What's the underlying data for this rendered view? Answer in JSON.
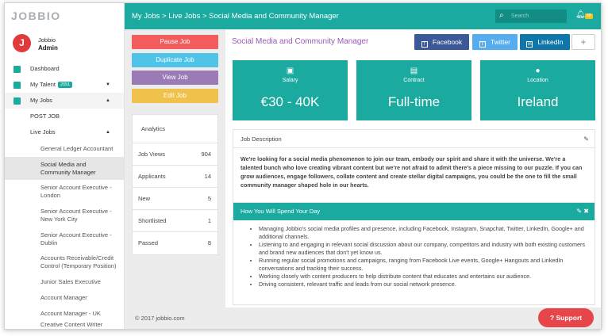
{
  "brand": {
    "logo": "JOBBIO"
  },
  "profile": {
    "initial": "J",
    "name": "Jobbio",
    "role": "Admin"
  },
  "nav": {
    "dashboard": "Dashboard",
    "talent": "My Talent",
    "talent_badge": "2051",
    "jobs": "My Jobs",
    "post_job": "POST JOB",
    "live_jobs": "Live Jobs",
    "live_items": [
      "General Ledger Accountant",
      "Social Media and Community Manager",
      "Senior Account Executive - London",
      "Senior Account Executive - New York City",
      "Senior Account Executive - Dublin",
      "Accounts Receivable/Credit Control (Temporary Position)",
      "Junior Sales Executive",
      "Account Manager",
      "Account Manager - UK",
      "Creative Content Writer"
    ]
  },
  "topbar": {
    "breadcrumb": "My Jobs > Live Jobs > Social Media and Community Manager",
    "search_placeholder": "Search",
    "notif_count": "99"
  },
  "actions": {
    "pause": "Pause Job",
    "duplicate": "Duplicate Job",
    "view": "View Job",
    "edit": "Edit Job"
  },
  "analytics": {
    "title": "Analytics",
    "rows": [
      {
        "label": "Job Views",
        "value": "904"
      },
      {
        "label": "Applicants",
        "value": "14"
      },
      {
        "label": "New",
        "value": "5"
      },
      {
        "label": "Shortlisted",
        "value": "1"
      },
      {
        "label": "Passed",
        "value": "8"
      }
    ]
  },
  "job": {
    "title": "Social Media and Community Manager",
    "share": {
      "facebook": "Facebook",
      "twitter": "Twitter",
      "linkedin": "LinkedIn",
      "more": "+"
    },
    "cards": [
      {
        "label": "Salary",
        "value": "€30 - 40K",
        "icon": "briefcase-icon"
      },
      {
        "label": "Contract",
        "value": "Full-time",
        "icon": "document-icon"
      },
      {
        "label": "Location",
        "value": "Ireland",
        "icon": "map-pin-icon"
      }
    ],
    "description_title": "Job Description",
    "description": "We're looking for a social media phenomenon to join our team, embody our spirit and share it with the universe. We're a talented bunch who love creating vibrant content but we're not afraid to admit there's a piece missing to our puzzle. If you can grow audiences, engage followers, collate content and create stellar digital campaigns, you could be the one to fill the small community manager shaped hole in our hearts.",
    "spend_title": "How You Will Spend Your Day",
    "spend_items": [
      "Managing Jobbio's social media profiles and presence, including Facebook, Instagram, Snapchat, Twitter, LinkedIn, Google+ and additional channels.",
      "Listening to and engaging in relevant social discussion about our company, competitors and industry with both existing customers and brand new audiences that don't yet know us.",
      "Running regular social promotions and campaigns, ranging from Facebook Live events, Google+ Hangouts and LinkedIn conversations and tracking their success.",
      "Working closely with content producers to help distribute content that educates and entertains our audience.",
      "Driving consistent, relevant traffic and leads from our social network presence."
    ]
  },
  "footer": {
    "copyright": "© 2017 jobbio.com"
  },
  "support": {
    "label": "Support"
  },
  "colors": {
    "teal": "#1aaa9f",
    "pause": "#f25c5c",
    "duplicate": "#4fc3e8",
    "view": "#9b7bb5",
    "edit": "#f0c14b",
    "facebook": "#3b5998",
    "twitter": "#55acee",
    "linkedin": "#0e76a8",
    "support": "#e6454a"
  }
}
